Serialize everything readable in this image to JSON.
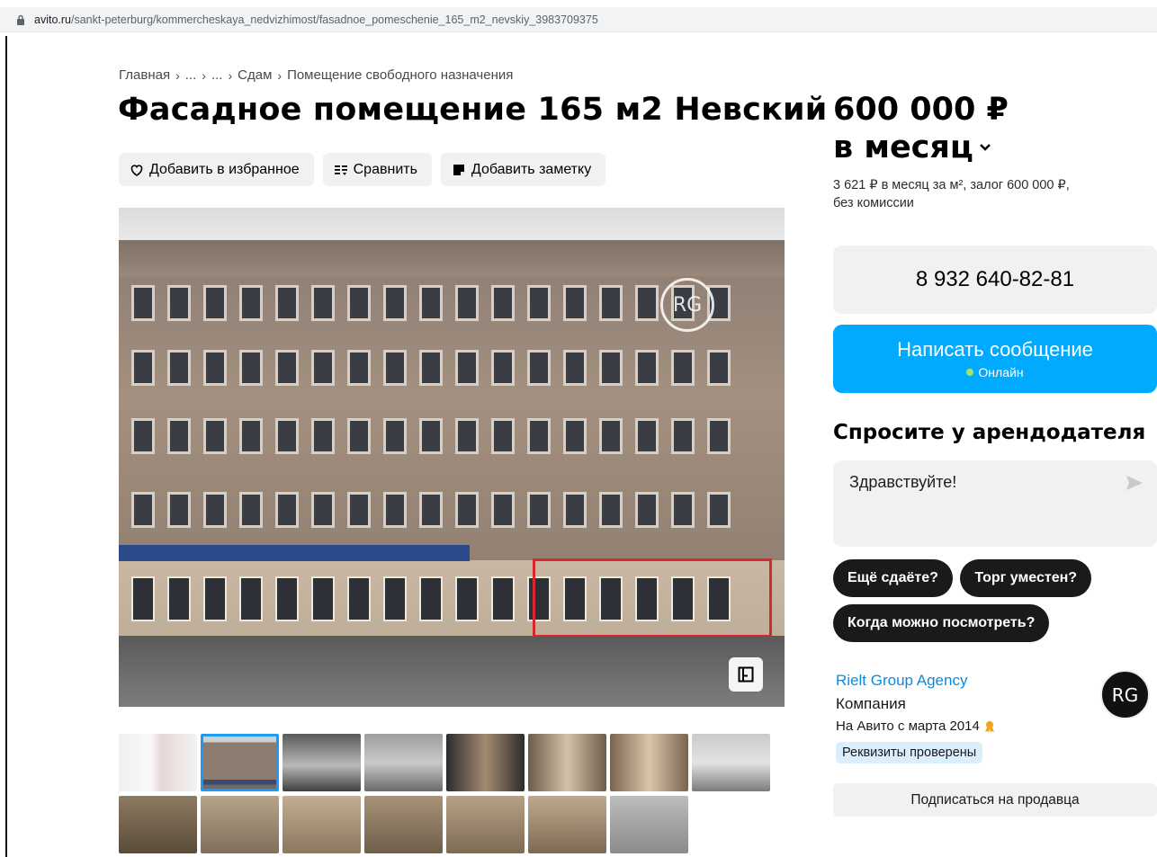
{
  "browser": {
    "url_host": "avito.ru",
    "url_path": "/sankt-peterburg/kommercheskaya_nedvizhimost/fasadnoe_pomeschenie_165_m2_nevskiy_3983709375"
  },
  "breadcrumb": {
    "items": [
      "Главная",
      "...",
      "...",
      "Сдам",
      "Помещение свободного назначения"
    ]
  },
  "listing": {
    "title": "Фасадное помещение 165 м2 Невский",
    "actions": {
      "favorite": "Добавить в избранное",
      "compare": "Сравнить",
      "note": "Добавить заметку"
    },
    "photo_watermark": "RG"
  },
  "price": {
    "amount": "600 000 ₽",
    "period": "в месяц",
    "details_line1": "3 621 ₽ в месяц за м², залог 600 000 ₽,",
    "details_line2": "без комиссии"
  },
  "contact": {
    "phone": "8 932 640-82-81",
    "message_button": "Написать сообщение",
    "status": "Онлайн"
  },
  "ask": {
    "title": "Спросите у арендодателя",
    "message_value": "Здравствуйте!",
    "quick_replies": [
      "Ещё сдаёте?",
      "Торг уместен?",
      "Когда можно посмотреть?"
    ]
  },
  "seller": {
    "name": "Rielt Group Agency",
    "type": "Компания",
    "since": "На Авито с марта 2014",
    "verified": "Реквизиты проверены",
    "logo_text": "RG",
    "subscribe": "Подписаться на продавца"
  },
  "colors": {
    "accent_blue": "#00aaff",
    "link_blue": "#0a8bdf",
    "button_bg": "#f2f1ef",
    "chip_dark": "#1a1a1a",
    "online_dot": "#a4e36b"
  }
}
